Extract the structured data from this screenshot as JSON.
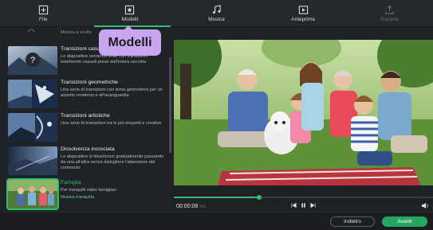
{
  "tabs": [
    {
      "label": "File",
      "icon": "file-add-icon"
    },
    {
      "label": "Modelli",
      "icon": "templates-icon"
    },
    {
      "label": "Musica",
      "icon": "music-note-icon"
    },
    {
      "label": "Anteprima",
      "icon": "play-preview-icon"
    },
    {
      "label": "Esporta",
      "icon": "export-icon"
    }
  ],
  "tooltip": "Modelli",
  "sidebar": {
    "top_category": "Musica a scelta",
    "items": [
      {
        "title": "Transizioni casuali",
        "desc": "Le diapositive verranno unite con transizioni totalmente casuali prese dall'intera raccolta",
        "category": ""
      },
      {
        "title": "Transizioni geometriche",
        "desc": "Una serie di transizioni con tema geometrico per un aspetto moderno e all'avanguardia",
        "category": ""
      },
      {
        "title": "Transizioni artistiche",
        "desc": "Una serie di transizioni tra le più eleganti e creative",
        "category": ""
      },
      {
        "title": "Dissolvenza incrociata",
        "desc": "Le diapositive si dissolvono gradualmente passando da una all'altra senza distogliere l'attenzione dal contenuto",
        "category": ""
      },
      {
        "title": "Famiglia",
        "desc": "Per tranquilli video famigliari",
        "category": "Musica tranquilla"
      }
    ]
  },
  "player": {
    "time": "00:00:08",
    "time_frac": "581",
    "progress": 0.33
  },
  "buttons": {
    "back": "Indietro",
    "next": "Avanti"
  },
  "colors": {
    "accent": "#2fbf71",
    "tooltip": "#c9a7f0"
  }
}
